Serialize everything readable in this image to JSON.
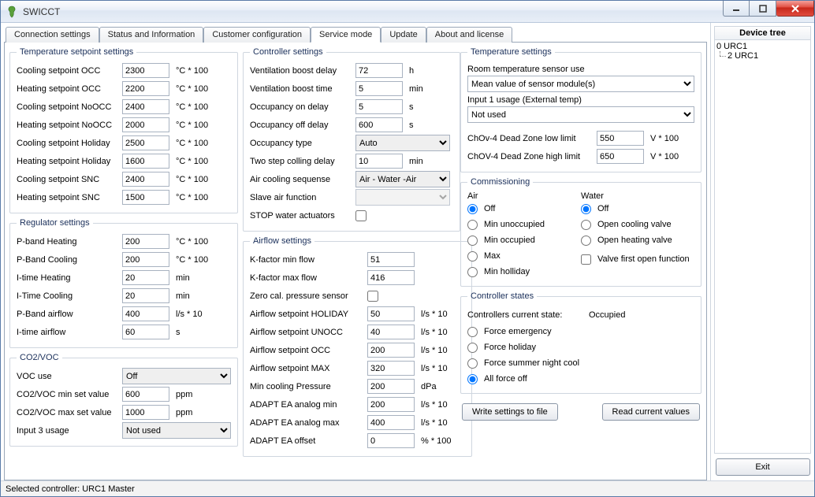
{
  "window": {
    "title": "SWICCT"
  },
  "tabs": [
    "Connection settings",
    "Status and Information",
    "Customer configuration",
    "Service mode",
    "Update",
    "About and license"
  ],
  "active_tab": "Service mode",
  "device_tree": {
    "header": "Device tree",
    "root": "0 URC1",
    "child": "2 URC1"
  },
  "exit_label": "Exit",
  "statusbar": "Selected controller: URC1 Master",
  "btn_write": "Write settings to file",
  "btn_read": "Read current values",
  "temp_set": {
    "legend": "Temperature setpoint settings",
    "rows": [
      {
        "label": "Cooling setpoint OCC",
        "value": "2300",
        "unit": "°C * 100"
      },
      {
        "label": "Heating setpoint OCC",
        "value": "2200",
        "unit": "°C * 100"
      },
      {
        "label": "Cooling setpoint NoOCC",
        "value": "2400",
        "unit": "°C * 100"
      },
      {
        "label": "Heating setpoint NoOCC",
        "value": "2000",
        "unit": "°C * 100"
      },
      {
        "label": "Cooling setpoint Holiday",
        "value": "2500",
        "unit": "°C * 100"
      },
      {
        "label": "Heating setpoint Holiday",
        "value": "1600",
        "unit": "°C * 100"
      },
      {
        "label": "Cooling setpoint SNC",
        "value": "2400",
        "unit": "°C * 100"
      },
      {
        "label": "Heating setpoint SNC",
        "value": "1500",
        "unit": "°C * 100"
      }
    ]
  },
  "regulator": {
    "legend": "Regulator settings",
    "rows": [
      {
        "label": "P-band Heating",
        "value": "200",
        "unit": "°C * 100"
      },
      {
        "label": "P-Band Cooling",
        "value": "200",
        "unit": "°C * 100"
      },
      {
        "label": "I-time Heating",
        "value": "20",
        "unit": "min"
      },
      {
        "label": "I-Time Cooling",
        "value": "20",
        "unit": "min"
      },
      {
        "label": "P-Band airflow",
        "value": "400",
        "unit": "l/s * 10"
      },
      {
        "label": "I-time airflow",
        "value": "60",
        "unit": "s"
      }
    ]
  },
  "co2voc": {
    "legend": "CO2/VOC",
    "voc_use_label": "VOC use",
    "voc_use_value": "Off",
    "min_label": "CO2/VOC min set value",
    "min_value": "600",
    "min_unit": "ppm",
    "max_label": "CO2/VOC max set value",
    "max_value": "1000",
    "max_unit": "ppm",
    "input3_label": "Input 3 usage",
    "input3_value": "Not used"
  },
  "controller": {
    "legend": "Controller settings",
    "rows": [
      {
        "label": "Ventilation boost delay",
        "value": "72",
        "unit": "h"
      },
      {
        "label": "Ventilation boost time",
        "value": "5",
        "unit": "min"
      },
      {
        "label": "Occupancy on delay",
        "value": "5",
        "unit": "s"
      },
      {
        "label": "Occupancy off delay",
        "value": "600",
        "unit": "s"
      }
    ],
    "occ_type_label": "Occupancy type",
    "occ_type_value": "Auto",
    "twostep_label": "Two step colling delay",
    "twostep_value": "10",
    "twostep_unit": "min",
    "aircool_label": "Air cooling sequense",
    "aircool_value": "Air - Water -Air",
    "slave_label": "Slave air function",
    "stop_label": "STOP water actuators"
  },
  "airflow": {
    "legend": "Airflow settings",
    "rows": [
      {
        "label": "K-factor min flow",
        "value": "51",
        "unit": ""
      },
      {
        "label": "K-factor max flow",
        "value": "416",
        "unit": ""
      }
    ],
    "zero_label": "Zero cal. pressure sensor",
    "rows2": [
      {
        "label": "Airflow setpoint HOLIDAY",
        "value": "50",
        "unit": "l/s * 10"
      },
      {
        "label": "Airflow setpoint UNOCC",
        "value": "40",
        "unit": "l/s * 10"
      },
      {
        "label": "Airflow setpoint OCC",
        "value": "200",
        "unit": "l/s * 10"
      },
      {
        "label": "Airflow setpoint MAX",
        "value": "320",
        "unit": "l/s * 10"
      },
      {
        "label": "Min cooling Pressure",
        "value": "200",
        "unit": "dPa"
      },
      {
        "label": "ADAPT EA analog min",
        "value": "200",
        "unit": "l/s * 10"
      },
      {
        "label": "ADAPT EA analog max",
        "value": "400",
        "unit": "l/s * 10"
      },
      {
        "label": "ADAPT EA offset",
        "value": "0",
        "unit": "% * 100"
      }
    ]
  },
  "temp_settings": {
    "legend": "Temperature settings",
    "room_label": "Room temperature sensor use",
    "room_value": "Mean value of sensor module(s)",
    "input1_label": "Input 1 usage (External temp)",
    "input1_value": "Not used",
    "dz_low_label": "ChOv-4 Dead Zone low limit",
    "dz_low_value": "550",
    "dz_unit": "V * 100",
    "dz_high_label": "ChOV-4 Dead Zone high limit",
    "dz_high_value": "650"
  },
  "commissioning": {
    "legend": "Commissioning",
    "air_header": "Air",
    "water_header": "Water",
    "air": [
      "Off",
      "Min unoccupied",
      "Min occupied",
      "Max",
      "Min holliday"
    ],
    "water": [
      "Off",
      "Open cooling valve",
      "Open heating valve"
    ],
    "valve_label": "Valve first open function"
  },
  "states": {
    "legend": "Controller states",
    "current_label": "Controllers current state:",
    "current_value": "Occupied",
    "opts": [
      "Force emergency",
      "Force holiday",
      "Force summer night cool",
      "All force off"
    ]
  }
}
